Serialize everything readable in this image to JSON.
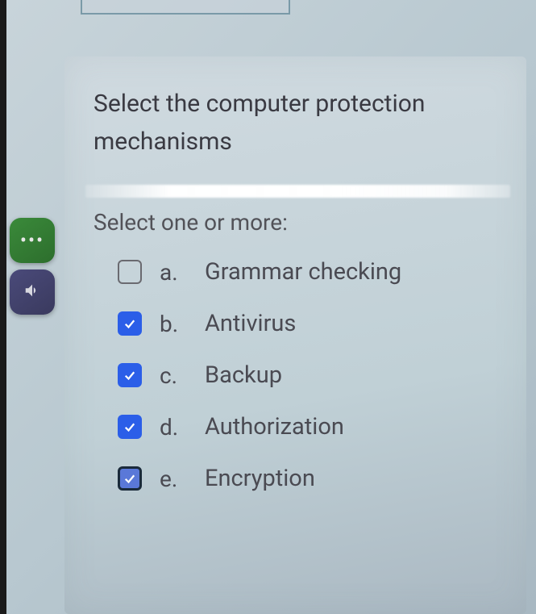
{
  "question": {
    "text": "Select the computer protection mechanisms",
    "instruction": "Select one or more:"
  },
  "options": [
    {
      "letter": "a.",
      "label": "Grammar checking",
      "checked": false
    },
    {
      "letter": "b.",
      "label": "Antivirus",
      "checked": true
    },
    {
      "letter": "c.",
      "label": "Backup",
      "checked": true
    },
    {
      "letter": "d.",
      "label": "Authorization",
      "checked": true
    },
    {
      "letter": "e.",
      "label": "Encryption",
      "checked": true
    }
  ],
  "sidebar": {
    "menu": "•••",
    "speaker": "speaker-icon"
  }
}
